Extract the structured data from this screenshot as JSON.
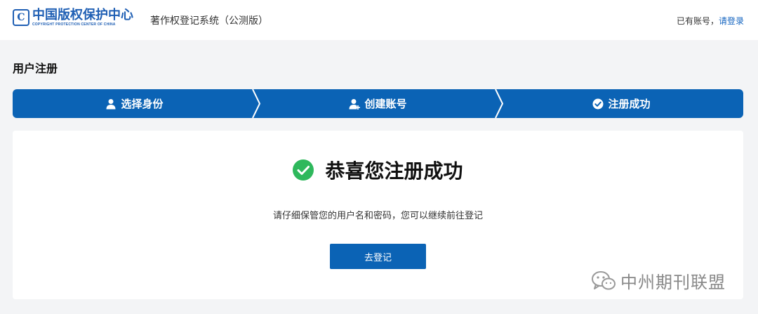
{
  "header": {
    "logo_mark": "C",
    "logo_cn": "中国版权保护中心",
    "logo_en": "COPYRIGHT PROTECTION CENTER OF CHINA",
    "system_name": "著作权登记系统（公测版）",
    "have_account_text": "已有账号，",
    "login_link": "请登录"
  },
  "page": {
    "title": "用户注册"
  },
  "steps": [
    {
      "label": "选择身份",
      "icon": "user-icon"
    },
    {
      "label": "创建账号",
      "icon": "add-user-icon"
    },
    {
      "label": "注册成功",
      "icon": "check-circle-icon"
    }
  ],
  "result": {
    "title": "恭喜您注册成功",
    "description": "请仔细保管您的用户名和密码，您可以继续前往登记",
    "button_label": "去登记"
  },
  "watermark": {
    "text": "中州期刊联盟",
    "icon": "wechat-icon"
  },
  "colors": {
    "primary": "#0b63b5",
    "success": "#2eb85c",
    "logo_blue": "#1f5fb4",
    "background": "#f3f4f6"
  }
}
